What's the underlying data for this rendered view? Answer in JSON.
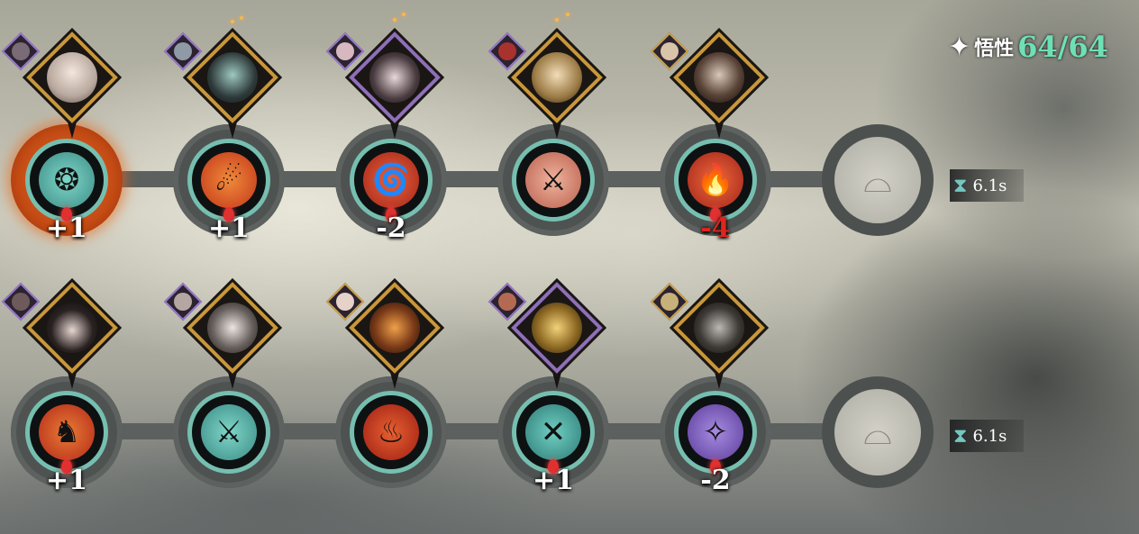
{
  "stat": {
    "icon": "insight-star-icon",
    "label": "悟性",
    "value": "64/64"
  },
  "rows": [
    {
      "timer": "6.1s",
      "slots": [
        {
          "delta": "+1",
          "delta_color": "white",
          "active": true,
          "skill": "swirl-beast-icon",
          "orb": "teal",
          "portrait": "white-haired-hero",
          "frame": "gold"
        },
        {
          "delta": "+1",
          "delta_color": "white",
          "active": false,
          "skill": "flame-slash-icon",
          "orb": "teal",
          "portrait": "masked-lady",
          "frame": "gold"
        },
        {
          "delta": "-2",
          "delta_color": "white",
          "active": false,
          "skill": "fire-tornado-icon",
          "orb": "teal",
          "portrait": "dark-queen",
          "frame": "purple"
        },
        {
          "delta": "",
          "delta_color": "white",
          "active": false,
          "skill": "broken-blade-icon",
          "orb": "teal",
          "portrait": "golden-prince",
          "frame": "gold"
        },
        {
          "delta": "-4",
          "delta_color": "red",
          "active": false,
          "skill": "fire-burst-icon",
          "orb": "teal",
          "portrait": "red-eyed-knight",
          "frame": "gold"
        }
      ]
    },
    {
      "timer": "6.1s",
      "slots": [
        {
          "delta": "+1",
          "delta_color": "white",
          "active": false,
          "skill": "charging-fire-icon",
          "orb": "teal",
          "portrait": "black-haired-lady",
          "frame": "gold"
        },
        {
          "delta": "",
          "delta_color": "white",
          "active": false,
          "skill": "crossed-swords-icon",
          "orb": "teal",
          "portrait": "pale-swordsman",
          "frame": "gold"
        },
        {
          "delta": "",
          "delta_color": "white",
          "active": false,
          "skill": "flame-pillar-icon",
          "orb": "teal",
          "portrait": "burning-warrior",
          "frame": "gold"
        },
        {
          "delta": "+1",
          "delta_color": "white",
          "active": false,
          "skill": "blade-cross-icon",
          "orb": "teal",
          "portrait": "golden-automaton",
          "frame": "purple"
        },
        {
          "delta": "-2",
          "delta_color": "white",
          "active": false,
          "skill": "violet-slash-icon",
          "orb": "teal",
          "portrait": "bearded-elder",
          "frame": "gold"
        }
      ]
    }
  ],
  "colors": {
    "accent_value": "#6ee0b6",
    "negative": "#e0251c",
    "frame_gold": "#c9973a",
    "frame_purple": "#8e6fb8",
    "orb_ring": "#76bfb0"
  }
}
